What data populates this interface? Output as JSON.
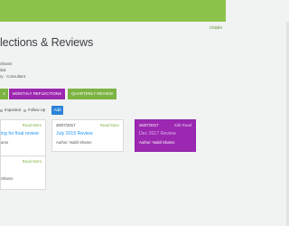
{
  "breadcrumb": "Childre",
  "page_title": "lections & Reviews",
  "meta": [
    "Shams",
    "itial",
    "ry - Consultant"
  ],
  "tabs": [
    {
      "label": "s",
      "color": "#7cb342"
    },
    {
      "label": "MONTHLY REFLECTIONS",
      "color": "#9c27b0"
    },
    {
      "label": "QUARTERLY REVIEW",
      "color": "#7cb342"
    }
  ],
  "filters": {
    "important_label": "Important",
    "follow_up_label": "Follow Up",
    "add_label": "Add"
  },
  "cards": [
    {
      "date": "",
      "read_more": "Read More",
      "title": "ing for final review",
      "author": "ams"
    },
    {
      "date": "28/07/2017",
      "read_more": "Read More",
      "title": "July 2015 Review",
      "author": "Author: Nabil Shams"
    },
    {
      "date": "26/07/2017",
      "read_more": "Edit Read",
      "title": "Dec 2017 Review",
      "author": "Author: Nabil Shams"
    },
    {
      "date": "",
      "read_more": "Read More",
      "title": "",
      "author": "Shams"
    }
  ],
  "colors": {
    "topbar": "#8bc34a",
    "accent_green": "#7cb342",
    "accent_purple": "#9c27b0",
    "add_button": "#2b82d9",
    "link_blue": "#2196f3"
  }
}
